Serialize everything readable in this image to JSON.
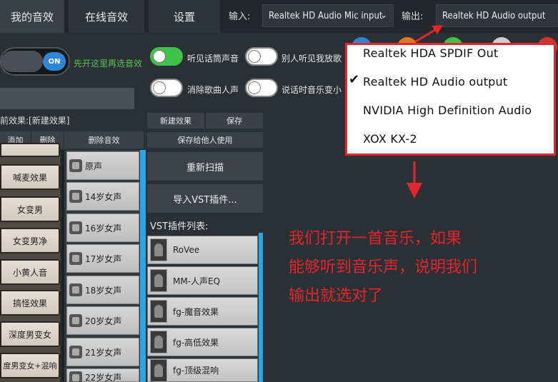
{
  "tabs": [
    {
      "label": "我的音效"
    },
    {
      "label": "在线音效"
    },
    {
      "label": "设置"
    }
  ],
  "io": {
    "input_label": "输入:",
    "input_value": "Realtek HD Audio Mic input",
    "output_label": "输出:",
    "output_value": "Realtek HD Audio output"
  },
  "switches": {
    "main_toggle_state": "ON",
    "main_hint": "先开这里再选音效",
    "hear_bgm": "听见话筒声音",
    "others_hear": "别人听见我放歌",
    "remove_vocal": "消除歌曲人声",
    "talk_music": "说话时音乐变小"
  },
  "effects": {
    "current_label": "前效果:[新建效果]",
    "add": "添加",
    "delete": "删除",
    "delete_effect": "删除音效",
    "new_effect": "新建效果",
    "save": "保存",
    "save_for_others": "保存给他人使用",
    "rescan": "重新扫描",
    "import_vst": "导入VST插件...",
    "vst_list_label": "VST插件列表:"
  },
  "left_list": [
    "喊麦效果",
    "女变男",
    "女变男净",
    "小黄人音",
    "搞怪效果",
    "深度男变女",
    "度男变女+混响"
  ],
  "mid_list": [
    "原声",
    "14岁女声",
    "16岁女声",
    "17岁女声",
    "18岁女声",
    "20岁女声",
    "21岁女声",
    "22岁女声"
  ],
  "vst_list": [
    "RoVee",
    "MM-人声EQ",
    "fg-魔音效果",
    "fg-高低效果",
    "fg-顶级混响"
  ],
  "dropdown": {
    "items": [
      {
        "label": "Realtek HDA SPDIF Out",
        "selected": false
      },
      {
        "label": "Realtek HD Audio output",
        "selected": true
      },
      {
        "label": "NVIDIA High Definition Audio",
        "selected": false
      },
      {
        "label": "XOX KX-2",
        "selected": false
      }
    ],
    "check_glyph": "✔"
  },
  "annotation": {
    "line1": "我们打开一首音乐，如果",
    "line2": "能够听到音乐声，说明我们",
    "line3": "输出就选对了"
  },
  "colors": {
    "accent_blue": "#2aa6e6",
    "annotation_red": "#e3262b",
    "toggle_green": "#3fc24a"
  }
}
